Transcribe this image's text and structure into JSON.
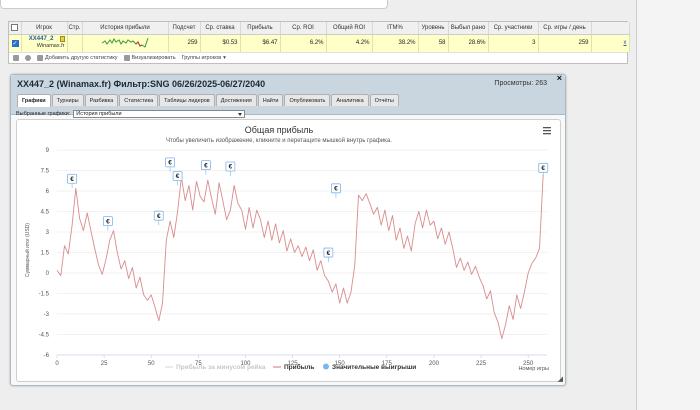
{
  "table": {
    "headers": [
      "",
      "Игрок",
      "Стр.",
      "История прибыли",
      "Подсчет",
      "Ср. ставка",
      "Прибыль",
      "Ср. ROI",
      "Общий ROI",
      "ITM%",
      "Уровень",
      "Выбыл рано",
      "Ср. участники",
      "Ср. игры / день",
      ""
    ],
    "row": {
      "player": "XX447_2",
      "site": "Winamax.fr",
      "count": "259",
      "avg_stake": "$0.53",
      "profit": "$6.47",
      "avg_roi": "6.2%",
      "total_roi": "4.2%",
      "itm": "38.2%",
      "level": "58",
      "early_bust": "28.6%",
      "avg_entrants": "3",
      "games_per_day": "259",
      "x": "x"
    },
    "toolbar": {
      "add_stats": "Добавить другую статистику",
      "visualize": "Визуализировать",
      "player_groups": "Группы игроков"
    }
  },
  "panel": {
    "title": "XX447_2 (Winamax.fr) Фильтр:SNG 06/26/2025-06/27/2040",
    "views": "Просмотры: 263",
    "close": "×",
    "tabs": [
      "Графики",
      "Турниры",
      "Разбивка",
      "Статистика",
      "Таблицы лидеров",
      "Достижения",
      "Найти",
      "Опубликовать",
      "Аналитика",
      "Отчёты"
    ],
    "graph_select_label": "Выбранные графики:",
    "graph_select_value": "История прибыли"
  },
  "chart_data": {
    "type": "line",
    "title": "Общая прибыль",
    "subtitle": "Чтобы увеличить изображение, кликните и перетащите мышкой внутрь графика.",
    "ylabel": "Суммарный итог (USD)",
    "xlabel": "Номер игры",
    "xlim": [
      0,
      260
    ],
    "ylim": [
      -6,
      9
    ],
    "xticks": [
      0,
      25,
      50,
      75,
      100,
      125,
      150,
      175,
      200,
      225,
      250
    ],
    "yticks": [
      9,
      7.5,
      6,
      4.5,
      3,
      1.5,
      0,
      -1.5,
      -3,
      -4.5,
      -6
    ],
    "grid": true,
    "legend_position": "bottom",
    "legend": [
      "Прибыль за минусом рейка",
      "Прибыль",
      "Значительные выигрыши"
    ],
    "series": [
      {
        "name": "Прибыль",
        "color": "#d98c8c",
        "x": [
          0,
          2,
          4,
          6,
          8,
          10,
          12,
          14,
          16,
          18,
          20,
          22,
          24,
          26,
          28,
          30,
          32,
          34,
          36,
          38,
          40,
          42,
          44,
          46,
          48,
          50,
          52,
          54,
          56,
          58,
          60,
          62,
          64,
          66,
          68,
          70,
          72,
          74,
          76,
          78,
          80,
          82,
          84,
          86,
          88,
          90,
          92,
          94,
          96,
          98,
          100,
          102,
          104,
          106,
          108,
          110,
          112,
          114,
          116,
          118,
          120,
          122,
          124,
          126,
          128,
          130,
          132,
          134,
          136,
          138,
          140,
          142,
          144,
          146,
          148,
          150,
          152,
          154,
          156,
          158,
          160,
          162,
          164,
          166,
          168,
          170,
          172,
          174,
          176,
          178,
          180,
          182,
          184,
          186,
          188,
          190,
          192,
          194,
          196,
          198,
          200,
          202,
          204,
          206,
          208,
          210,
          212,
          214,
          216,
          218,
          220,
          222,
          224,
          226,
          228,
          230,
          232,
          234,
          236,
          238,
          240,
          242,
          244,
          246,
          248,
          250,
          252,
          254,
          256,
          258
        ],
        "y": [
          0.2,
          -0.2,
          2,
          1.4,
          3.5,
          6.2,
          4,
          3.1,
          4.4,
          3.1,
          1.8,
          0.6,
          -0.1,
          1,
          2.4,
          3.1,
          1.5,
          0.3,
          0.9,
          -0.4,
          0.4,
          -1.1,
          -0.3,
          -1.6,
          -2,
          -1.6,
          -2.5,
          -3.5,
          -2.2,
          2.4,
          3.8,
          2.6,
          4.5,
          7,
          5.3,
          6.4,
          4.6,
          6.7,
          5.6,
          5.2,
          6.8,
          5.5,
          4.3,
          6.6,
          5.3,
          3.9,
          4.6,
          6.4,
          5.1,
          4.6,
          3.2,
          4.8,
          3.3,
          4.6,
          3.9,
          2.6,
          3.8,
          2.4,
          3.6,
          2.2,
          3.1,
          1.6,
          2.5,
          1.5,
          2,
          1.2,
          1.9,
          0.9,
          1.7,
          0.2,
          0.9,
          -0.2,
          -0.6,
          -1.4,
          -0.8,
          -2.2,
          -1.1,
          -2.2,
          -1.4,
          0.6,
          5.7,
          5.3,
          5.8,
          5.1,
          4.3,
          4.8,
          3.5,
          4.6,
          3.1,
          4.2,
          2.4,
          3.3,
          1.8,
          2.7,
          1.6,
          3.6,
          4.5,
          3.3,
          4.6,
          3.5,
          3.8,
          2.5,
          3.3,
          2.1,
          3,
          1.8,
          0.4,
          1.1,
          0.2,
          0.8,
          -0.1,
          0.5,
          -0.3,
          -0.9,
          -1.9,
          -1.3,
          -2.9,
          -3.6,
          -4.8,
          -3.8,
          -2.4,
          -3.4,
          -1.6,
          -2.6,
          -1.4,
          0,
          0.7,
          1.1,
          1.8,
          7.2
        ]
      }
    ],
    "big_win_points": [
      [
        8,
        6.2
      ],
      [
        27,
        3.1
      ],
      [
        54,
        3.5
      ],
      [
        60,
        7.4
      ],
      [
        64,
        6.4
      ],
      [
        79,
        7.2
      ],
      [
        92,
        7.1
      ],
      [
        144,
        0.8
      ],
      [
        148,
        5.5
      ],
      [
        258,
        7.0
      ]
    ],
    "big_win_marker": "€",
    "colors": {
      "profit": "#d98c8c",
      "rake_series": "#dddddd",
      "big_win": "#7cb5ec"
    }
  }
}
